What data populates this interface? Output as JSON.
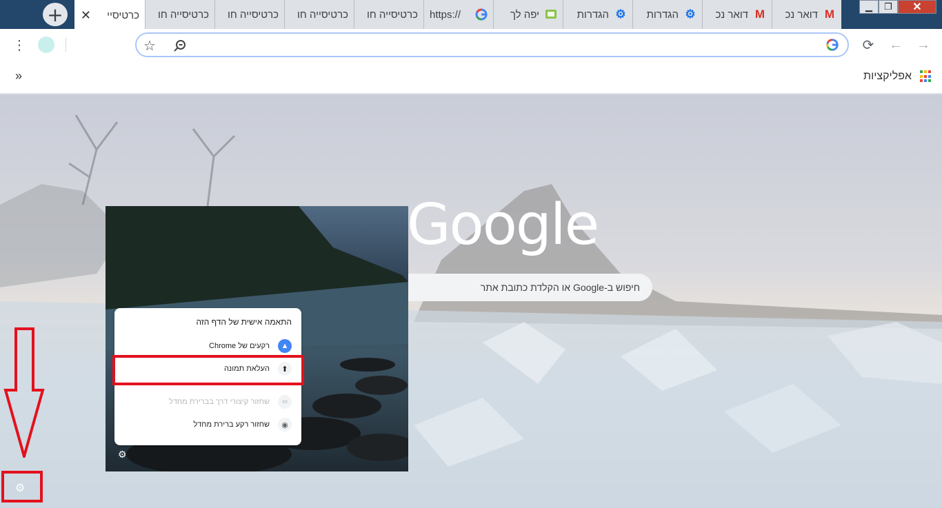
{
  "tabs": [
    {
      "title": "כרטיסיי",
      "favicon": "none",
      "active": true
    },
    {
      "title": "כרטיסייה חו",
      "favicon": "none",
      "active": false
    },
    {
      "title": "כרטיסייה חו",
      "favicon": "none",
      "active": false
    },
    {
      "title": "כרטיסייה חו",
      "favicon": "none",
      "active": false
    },
    {
      "title": "כרטיסייה חו",
      "favicon": "none",
      "active": false
    },
    {
      "title": "https://",
      "favicon": "google-g-icon",
      "active": false
    },
    {
      "title": "יפה לך",
      "favicon": "tv-icon",
      "active": false
    },
    {
      "title": "הגדרות",
      "favicon": "gear-icon",
      "active": false
    },
    {
      "title": "הגדרות",
      "favicon": "gear-icon",
      "active": false
    },
    {
      "title": "דואר נכ",
      "favicon": "gmail-icon",
      "active": false
    },
    {
      "title": "דואר נכ",
      "favicon": "gmail-icon",
      "active": false
    }
  ],
  "toolbar": {
    "omnibox_value": ""
  },
  "bookmarks": {
    "apps_label": "אפליקציות",
    "more": "»"
  },
  "ntp": {
    "logo": "Google",
    "search_placeholder": "חיפוש ב-Google או הקלדת כתובת אתר"
  },
  "customize_menu": {
    "title": "התאמה אישית של הדף הזה",
    "items": [
      {
        "label": "רקעים של Chrome",
        "icon": "mountain-icon",
        "disabled": false
      },
      {
        "label": "העלאת תמונה",
        "icon": "upload-icon",
        "disabled": false
      },
      {
        "label": "שחזור קיצורי דרך בברירת מחדל",
        "icon": "link-icon",
        "disabled": true
      },
      {
        "label": "שחזור רקע ברירת מחדל",
        "icon": "chrome-icon",
        "disabled": false
      }
    ]
  },
  "colors": {
    "highlight": "#e3111d",
    "tabstrip": "#23466b",
    "accent_blue": "#4285f4"
  }
}
